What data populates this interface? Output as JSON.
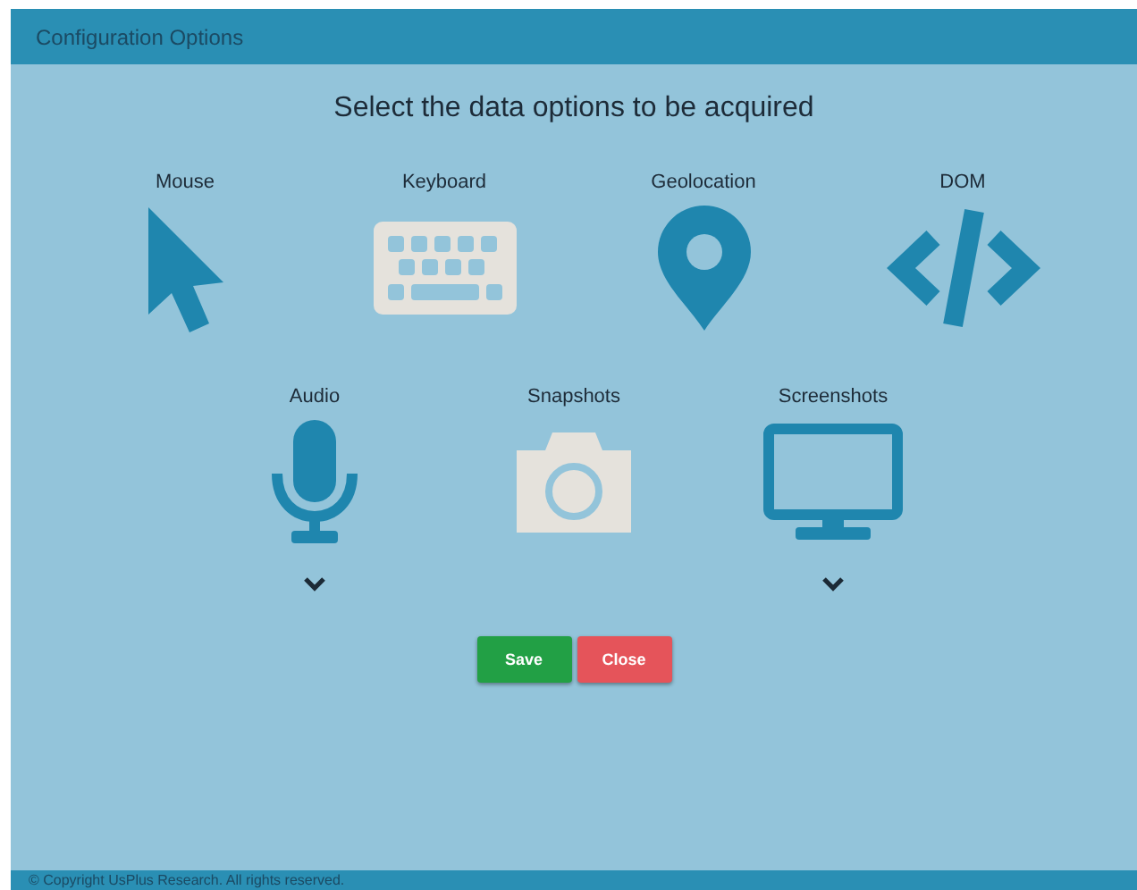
{
  "window": {
    "title": "Configuration Options"
  },
  "heading": "Select the data options to be acquired",
  "option_rows": [
    [
      {
        "label": "Mouse",
        "kind": "pointer",
        "selected": true,
        "expandable": false
      },
      {
        "label": "Keyboard",
        "kind": "keyboard",
        "selected": false,
        "expandable": false
      },
      {
        "label": "Geolocation",
        "kind": "pin",
        "selected": true,
        "expandable": false
      },
      {
        "label": "DOM",
        "kind": "code",
        "selected": true,
        "expandable": false
      }
    ],
    [
      {
        "label": "Audio",
        "kind": "microphone",
        "selected": true,
        "expandable": true
      },
      {
        "label": "Snapshots",
        "kind": "camera",
        "selected": false,
        "expandable": false
      },
      {
        "label": "Screenshots",
        "kind": "monitor",
        "selected": true,
        "expandable": true
      }
    ]
  ],
  "buttons": [
    {
      "label": "Save",
      "kind": "save"
    },
    {
      "label": "Close",
      "kind": "close"
    }
  ],
  "status_bar": "© Copyright UsPlus Research. All rights reserved."
}
